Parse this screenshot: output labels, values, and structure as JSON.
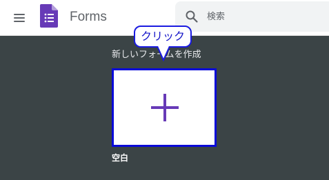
{
  "header": {
    "app_name": "Forms",
    "search": {
      "placeholder": "検索"
    }
  },
  "main": {
    "section_heading": "新しいフォームを作成",
    "blank_template": {
      "label": "空白"
    }
  },
  "annotation": {
    "callout_text": "クリック"
  },
  "colors": {
    "header_bg": "#ffffff",
    "template_area_bg": "#3b4446",
    "forms_brand": "#673ab7",
    "plus_icon": "#673ab7",
    "highlight_border": "#0a0ad8",
    "callout_text": "#1414c8"
  },
  "icons": {
    "menu": "menu-icon",
    "logo": "google-forms-logo",
    "search": "search-icon",
    "plus": "plus-icon"
  }
}
